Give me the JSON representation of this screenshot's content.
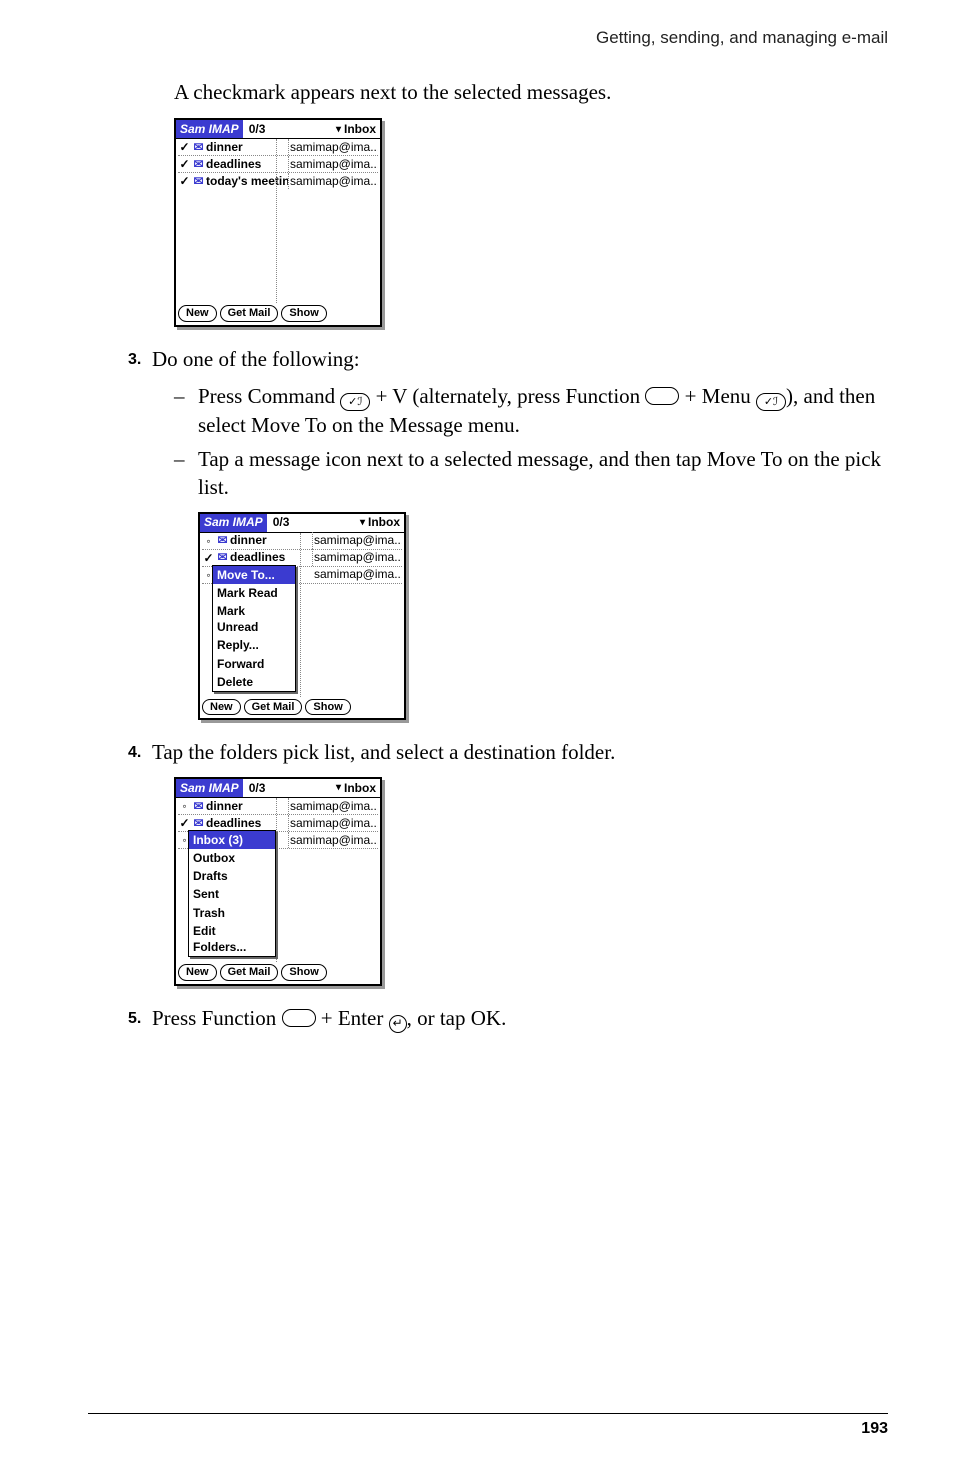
{
  "header": {
    "running": "Getting, sending, and managing e-mail"
  },
  "intro": "A checkmark appears next to the selected messages.",
  "shot1": {
    "app": "Sam IMAP",
    "count": "0/3",
    "folder": "Inbox",
    "rows": [
      {
        "mark": "✓",
        "subj": "dinner",
        "from": "samimap@ima..."
      },
      {
        "mark": "✓",
        "subj": "deadlines",
        "from": "samimap@ima..."
      },
      {
        "mark": "✓",
        "subj": "today's meetin...",
        "from": "samimap@ima..."
      }
    ],
    "buttons": {
      "new": "New",
      "get": "Get Mail",
      "show": "Show"
    }
  },
  "step3": {
    "num": "3.",
    "lead": "Do one of the following:",
    "b1a": "Press Command ",
    "b1b": " + V (alternately, press Function ",
    "b1c": " + Menu ",
    "b1d": "), and then select Move To on the Message menu.",
    "b2": "Tap a message icon next to a selected message, and then tap Move To on the pick list."
  },
  "shot2": {
    "app": "Sam IMAP",
    "count": "0/3",
    "folder": "Inbox",
    "rows": [
      {
        "mark": "◦",
        "subj": "dinner",
        "from": "samimap@ima..."
      },
      {
        "mark": "✓",
        "subj": "deadlines",
        "from": "samimap@ima..."
      },
      {
        "mark": "◦",
        "subj": "",
        "from": "samimap@ima..."
      }
    ],
    "menu": [
      "Move To...",
      "Mark Read",
      "Mark Unread",
      "Reply...",
      "Forward",
      "Delete"
    ],
    "buttons": {
      "new": "New",
      "get": "Get Mail",
      "show": "Show"
    }
  },
  "step4": {
    "num": "4.",
    "text": "Tap the folders pick list, and select a destination folder."
  },
  "shot3": {
    "app": "Sam IMAP",
    "count": "0/3",
    "folder": "Inbox",
    "rows": [
      {
        "mark": "◦",
        "subj": "dinner",
        "from": "samimap@ima..."
      },
      {
        "mark": "✓",
        "subj": "deadlines",
        "from": "samimap@ima..."
      },
      {
        "mark": "◦",
        "subj": "",
        "from": "samimap@ima..."
      }
    ],
    "menu": [
      "Inbox (3)",
      "Outbox",
      "Drafts",
      "Sent",
      "Trash",
      "Edit Folders..."
    ],
    "buttons": {
      "new": "New",
      "get": "Get Mail",
      "show": "Show"
    }
  },
  "step5": {
    "num": "5.",
    "a": "Press Function ",
    "b": " + Enter ",
    "c": ", or tap OK."
  },
  "glyphs": {
    "cmd": "✓ℐ",
    "enter": "↵"
  },
  "pagenum": "193"
}
